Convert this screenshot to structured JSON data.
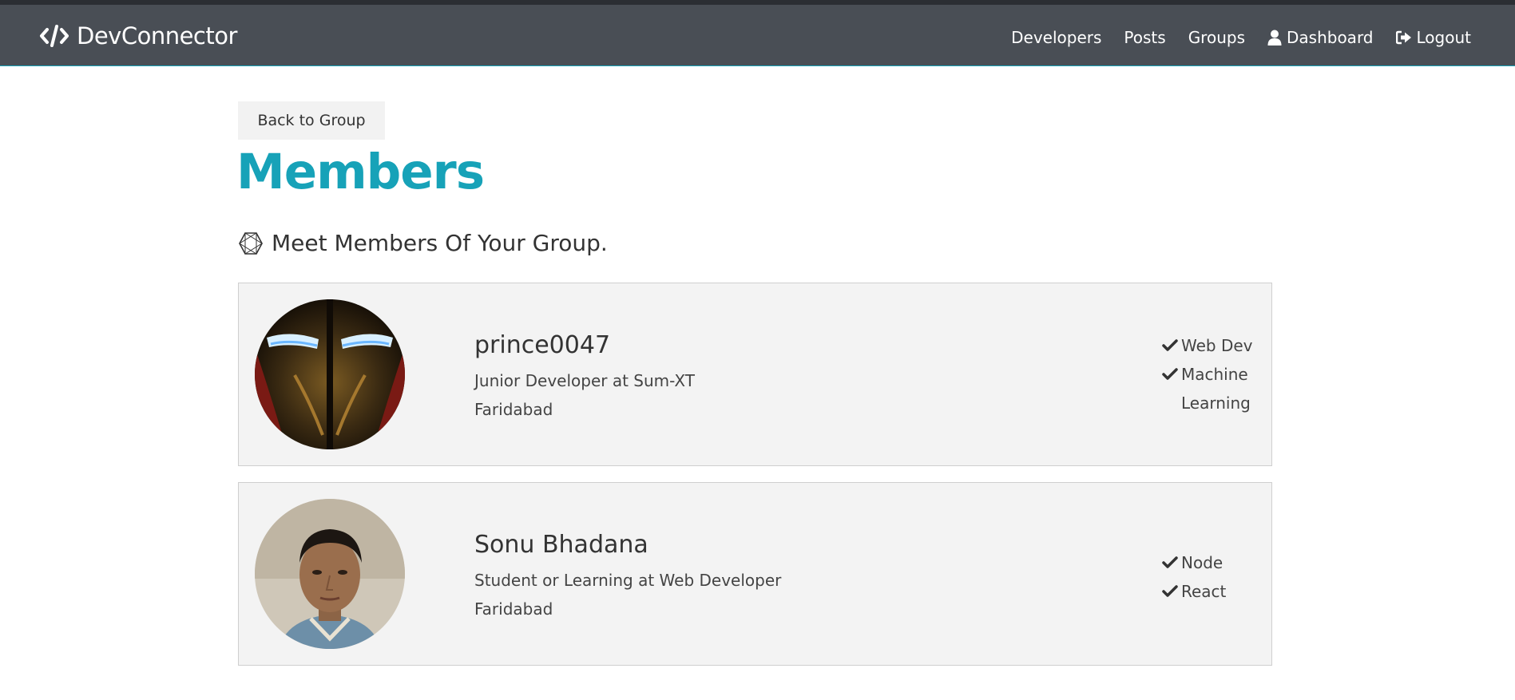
{
  "navbar": {
    "brand": "DevConnector",
    "links": [
      {
        "label": "Developers"
      },
      {
        "label": "Posts"
      },
      {
        "label": "Groups"
      },
      {
        "label": "Dashboard",
        "icon": "user-icon"
      },
      {
        "label": "Logout",
        "icon": "logout-icon"
      }
    ],
    "colors": {
      "background": "#494e55",
      "accent": "#17a2b8"
    }
  },
  "back_button": "Back to Group",
  "page_title": "Members",
  "lead": {
    "icon": "hexagon-icon",
    "text": "Meet Members Of Your Group."
  },
  "members": [
    {
      "name": "prince0047",
      "status": "Junior Developer at Sum-XT",
      "location": "Faridabad",
      "avatar": "iron-man-helmet",
      "skills": [
        "Web Dev",
        "Machine Learning"
      ]
    },
    {
      "name": "Sonu Bhadana",
      "status": "Student or Learning at Web Developer",
      "location": "Faridabad",
      "avatar": "portrait-photo",
      "skills": [
        "Node",
        "React"
      ]
    }
  ]
}
